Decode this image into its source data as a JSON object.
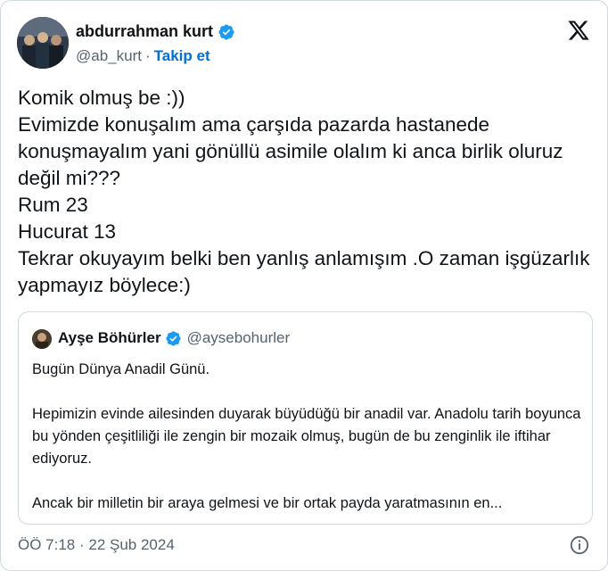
{
  "author": {
    "name": "abdurrahman kurt",
    "handle": "@ab_kurt",
    "separator": "·",
    "follow_label": "Takip et"
  },
  "tweet": {
    "text": "Komik olmuş be :))\nEvimizde konuşalım ama çarşıda pazarda hastanede konuşmayalım yani gönüllü asimile olalım ki anca birlik oluruz değil mi???\nRum 23\nHucurat 13\nTekrar okuyayım belki ben yanlış anlamışım .O zaman işgüzarlık yapmayız böylece:)"
  },
  "quote": {
    "name": "Ayşe Böhürler",
    "handle": "@aysebohurler",
    "text": "Bugün Dünya Anadil Günü.\n\nHepimizin evinde ailesinden duyarak büyüdüğü bir anadil var. Anadolu tarih boyunca bu yönden çeşitliliği ile zengin bir mozaik olmuş, bugün de bu zenginlik ile iftihar ediyoruz.\n\nAncak bir milletin bir araya gelmesi ve bir ortak payda yaratmasının en..."
  },
  "footer": {
    "timestamp": "ÖÖ 7:18 · 22 Şub 2024"
  },
  "icons": {
    "platform_logo": "x-logo-icon",
    "verified": "verified-badge-icon",
    "info": "info-icon"
  },
  "colors": {
    "verified_blue": "#1d9bf0",
    "link_blue": "#006fd6",
    "secondary_text": "#536471",
    "border": "#cfd9de"
  }
}
